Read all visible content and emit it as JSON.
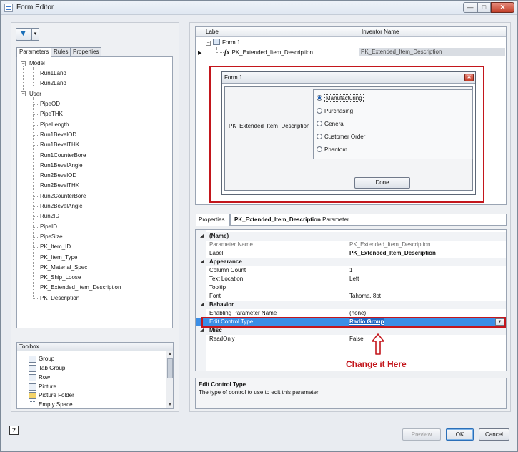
{
  "window": {
    "title": "Form Editor",
    "min_glyph": "—",
    "max_glyph": "□",
    "close_glyph": "✕"
  },
  "left": {
    "filter_glyph": "▼",
    "dropdown_glyph": "▾",
    "tabs": [
      "Parameters",
      "Rules",
      "Properties"
    ],
    "tree": {
      "model_label": "Model",
      "model_children": [
        "Run1Land",
        "Run2Land"
      ],
      "user_label": "User",
      "user_children": [
        "PipeOD",
        "PipeTHK",
        "PipeLength",
        "Run1BevelOD",
        "Run1BevelTHK",
        "Run1CounterBore",
        "Run1BevelAngle",
        "Run2BevelOD",
        "Run2BevelTHK",
        "Run2CounterBore",
        "Run2BevelAngle",
        "Run2ID",
        "PipeID",
        "PipeSize",
        "PK_Item_ID",
        "PK_Item_Type",
        "PK_Material_Spec",
        "PK_Ship_Loose",
        "PK_Extended_Item_Description",
        "PK_Description"
      ]
    },
    "toolbox": {
      "title": "Toolbox",
      "items": [
        "Group",
        "Tab Group",
        "Row",
        "Picture",
        "Picture Folder",
        "Empty Space"
      ]
    }
  },
  "grid": {
    "col_label": "Label",
    "col_inventor": "Inventor Name",
    "form_row": "Form 1",
    "param_row_label": "PK_Extended_Item_Description",
    "param_row_inventor": "PK_Extended_Item_Description",
    "fx_glyph": "fx"
  },
  "preview": {
    "title": "Form 1",
    "close_glyph": "✕",
    "label": "PK_Extended_Item_Description",
    "options": [
      "Manufacturing",
      "Purchasing",
      "General",
      "Customer Order",
      "Phantom"
    ],
    "selected_index": 0,
    "done_label": "Done"
  },
  "properties": {
    "tab_label": "Properties",
    "header_bold": "PK_Extended_Item_Description",
    "header_suffix": " Parameter",
    "cat_name": "(Name)",
    "param_name_key": "Parameter Name",
    "param_name_val": "PK_Extended_Item_Description",
    "label_key": "Label",
    "label_val": "PK_Extended_Item_Description",
    "cat_appearance": "Appearance",
    "column_count_key": "Column Count",
    "column_count_val": "1",
    "text_location_key": "Text Location",
    "text_location_val": "Left",
    "tooltip_key": "Tooltip",
    "font_key": "Font",
    "font_val": "Tahoma, 8pt",
    "cat_behavior": "Behavior",
    "enabling_key": "Enabling Parameter Name",
    "enabling_val": "(none)",
    "edit_control_key": "Edit Control Type",
    "edit_control_val": "Radio Group",
    "cat_misc": "Misc",
    "readonly_key": "ReadOnly",
    "readonly_val": "False",
    "collapse_glyph": "◢"
  },
  "annotation": {
    "text": "Change it Here",
    "color": "#c3161c"
  },
  "description": {
    "title": "Edit Control Type",
    "body": "The type of control to use to edit this parameter."
  },
  "footer": {
    "help_glyph": "?",
    "preview_label": "Preview",
    "ok_label": "OK",
    "cancel_label": "Cancel"
  }
}
